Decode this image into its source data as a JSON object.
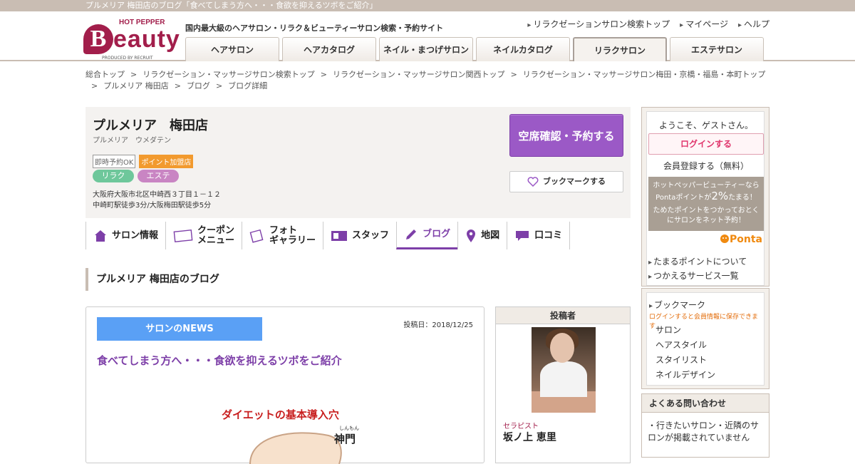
{
  "topbar": {
    "text": "プルメリア 梅田店のブログ「食べてしまう方へ・・・食欲を抑えるツボをご紹介」"
  },
  "logo": {
    "hotpepper": "HOT PEPPER",
    "b": "B",
    "eauty": "eauty",
    "produced": "PRODUCED BY RECRUIT"
  },
  "tagline": "国内最大級のヘアサロン・リラク＆ビューティーサロン検索・予約サイト",
  "toplinks": [
    "リラクゼーションサロン検索トップ",
    "マイページ",
    "ヘルプ"
  ],
  "navtabs": [
    "ヘアサロン",
    "ヘアカタログ",
    "ネイル・まつげサロン",
    "ネイルカタログ",
    "リラクサロン",
    "エステサロン"
  ],
  "breadcrumb": [
    "総合トップ",
    "リラクゼーション・マッサージサロン検索トップ",
    "リラクゼーション・マッサージサロン関西トップ",
    "リラクゼーション・マッサージサロン梅田・京橋・福島・本町トップ",
    "プルメリア 梅田店",
    "ブログ",
    "ブログ詳細"
  ],
  "breadcrumb_sep": ">",
  "salon": {
    "name": "プルメリア　梅田店",
    "kana": "プルメリア　ウメダテン",
    "badge_instant": "即時予約OK",
    "badge_point": "ポイント加盟店",
    "pill_relax": "リラク",
    "pill_este": "エステ",
    "address": "大阪府大阪市北区中崎西３丁目１－１２",
    "access": "中崎町駅徒歩3分/大阪梅田駅徒歩5分",
    "reserve_label": "空席確認・予約する",
    "bookmark_label": "ブックマークする"
  },
  "salon_tabs": {
    "info": "サロン情報",
    "coupon_1": "クーポン",
    "coupon_2": "メニュー",
    "photo_1": "フォト",
    "photo_2": "ギャラリー",
    "staff": "スタッフ",
    "blog": "ブログ",
    "map": "地図",
    "review": "口コミ"
  },
  "section_title": "プルメリア 梅田店のブログ",
  "post": {
    "category": "サロンのNEWS",
    "date": "投稿日：2018/12/25",
    "title": "食べてしまう方へ・・・食欲を抑えるツボをご紹介",
    "illus_title": "ダイエットの基本導入穴",
    "illus_ruby": "しんもん",
    "illus_point": "神門"
  },
  "author": {
    "header": "投稿者",
    "role": "セラピスト",
    "name": "坂ノ上 恵里"
  },
  "sidebar": {
    "welcome": "ようこそ、ゲストさん。",
    "login": "ログインする",
    "register": "会員登録する（無料）",
    "ponta_line1": "ホットペッパービューティーなら",
    "ponta_line2a": "Pontaポイントが",
    "ponta_pct": "2%",
    "ponta_line2b": "たまる！",
    "ponta_line3": "ためたポイントをつかっておとく",
    "ponta_line4": "にサロンをネット予約！",
    "ponta_logo": "Ponta",
    "links": [
      "たまるポイントについて",
      "つかえるサービス一覧"
    ],
    "bookmark_head": "ブックマーク",
    "bookmark_note": "ログインすると会員情報に保存できます",
    "bookmark_items": [
      "サロン",
      "ヘアスタイル",
      "スタイリスト",
      "ネイルデザイン"
    ],
    "faq_head": "よくある問い合わせ",
    "faq_q1": "・行きたいサロン・近隣のサロンが掲載されていません"
  },
  "colors": {
    "accent": "#9b59c6",
    "brand": "#a21e4b",
    "relax_pill": "#6ec79b",
    "este_pill": "#c985c3",
    "news": "#5aa0f5"
  }
}
